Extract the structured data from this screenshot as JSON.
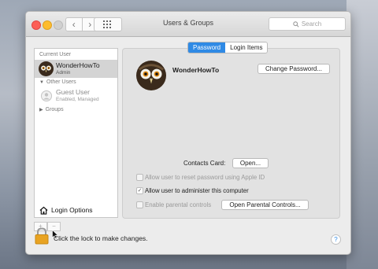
{
  "window": {
    "title": "Users & Groups"
  },
  "titlebar": {
    "back_glyph": "‹",
    "forward_glyph": "›"
  },
  "search": {
    "placeholder": "Search"
  },
  "sidebar": {
    "current_user_header": "Current User",
    "current_user": {
      "name": "WonderHowTo",
      "role": "Admin"
    },
    "other_users_header": "Other Users",
    "guest_user": {
      "name": "Guest User",
      "status": "Enabled, Managed"
    },
    "groups_label": "Groups",
    "login_options_label": "Login Options",
    "add_glyph": "+",
    "remove_glyph": "−"
  },
  "tabs": [
    {
      "label": "Password",
      "selected": true
    },
    {
      "label": "Login Items",
      "selected": false
    }
  ],
  "profile": {
    "name": "WonderHowTo"
  },
  "buttons": {
    "change_password": "Change Password...",
    "open": "Open...",
    "open_parental_controls": "Open Parental Controls..."
  },
  "contacts_card_label": "Contacts Card:",
  "options": [
    {
      "label": "Allow user to reset password using Apple ID",
      "checked": false,
      "enabled": false
    },
    {
      "label": "Allow user to administer this computer",
      "checked": true,
      "enabled": true
    },
    {
      "label": "Enable parental controls",
      "checked": false,
      "enabled": false
    }
  ],
  "footer": {
    "lock_message": "Click the lock to make changes.",
    "help_glyph": "?"
  },
  "colors": {
    "accent": "#2f8ae5",
    "lock": "#e8a322"
  }
}
